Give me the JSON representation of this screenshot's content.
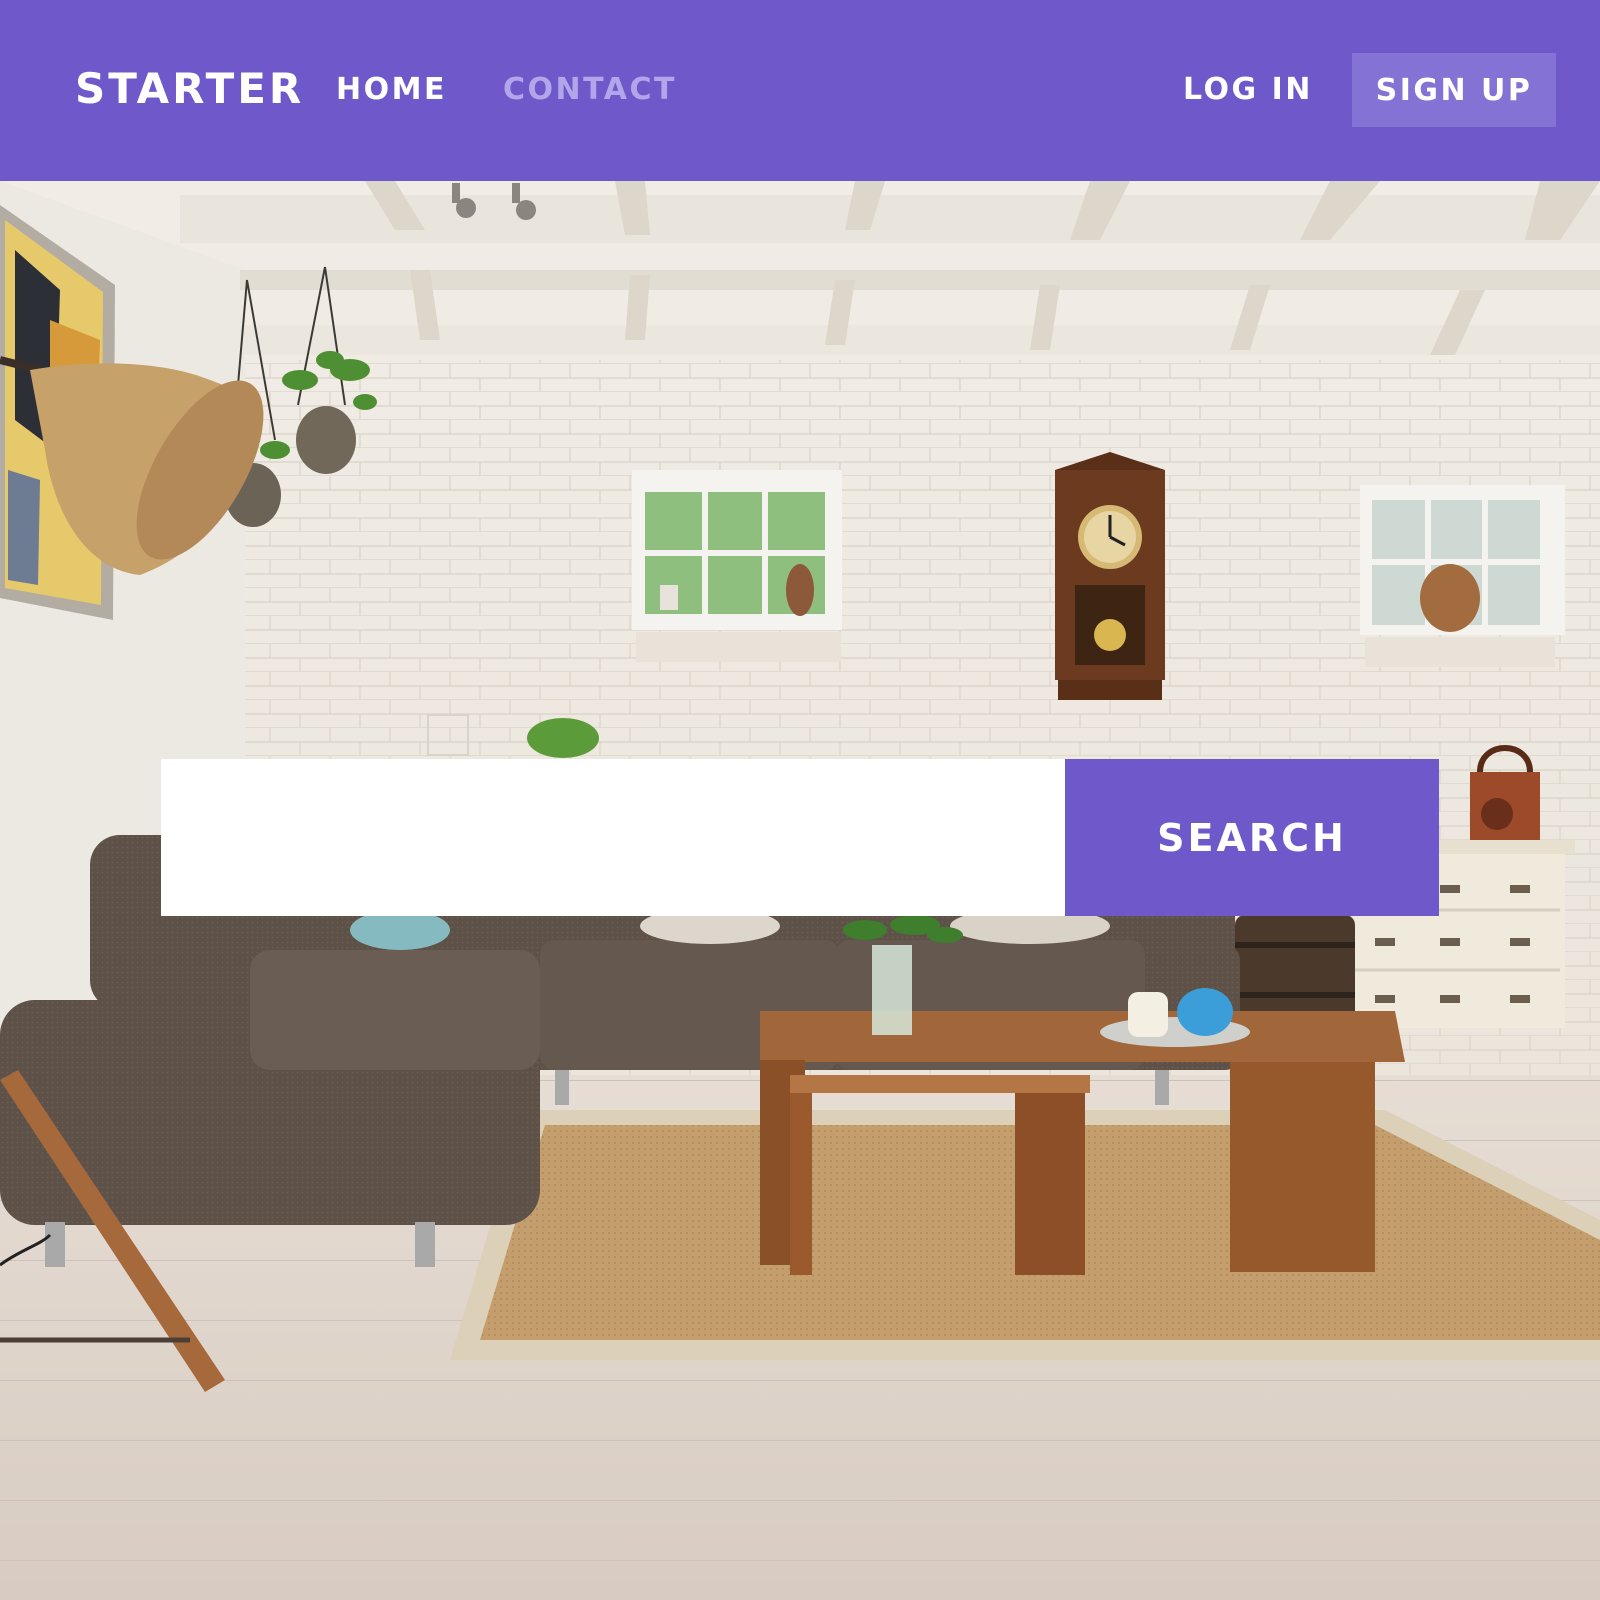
{
  "navbar": {
    "brand": "STARTER",
    "links": [
      {
        "label": "HOME",
        "active": true
      },
      {
        "label": "CONTACT",
        "active": false
      }
    ],
    "login_label": "LOG IN",
    "signup_label": "SIGN UP"
  },
  "search": {
    "value": "",
    "placeholder": "",
    "button_label": "SEARCH"
  },
  "hero": {
    "image_alt": "living room interior with sofa, wooden coffee table, rug, brick wall, clock and windows"
  },
  "colors": {
    "accent": "#6f58c9",
    "accent_light": "#8472d4",
    "link_inactive": "#b2a5ea",
    "text_light": "#ffffff"
  }
}
